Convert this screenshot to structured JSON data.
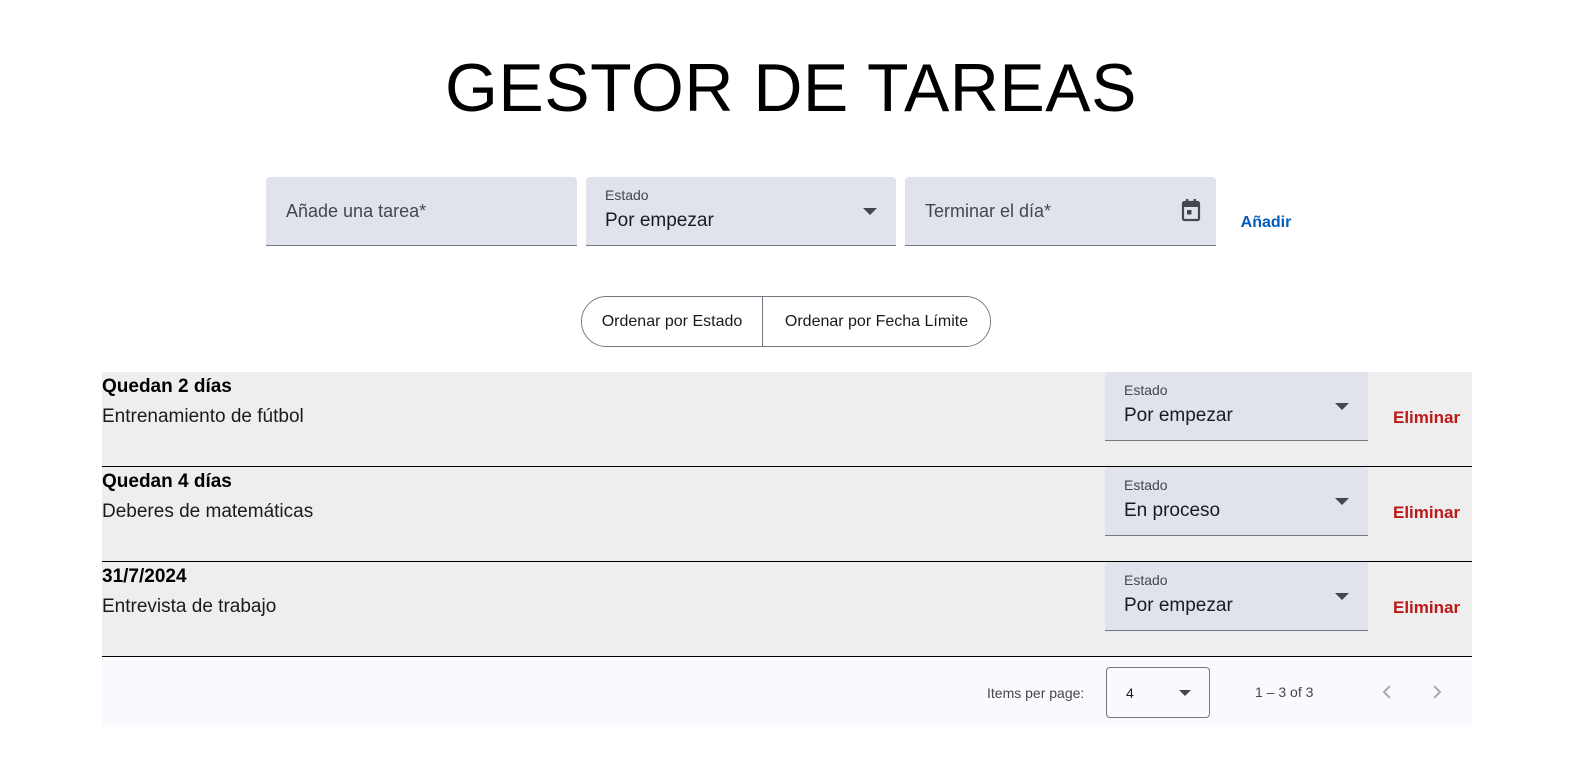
{
  "header": {
    "title": "GESTOR DE TAREAS"
  },
  "form": {
    "task_placeholder": "Añade una tarea*",
    "status_label": "Estado",
    "status_value": "Por empezar",
    "date_placeholder": "Terminar el día*",
    "add_label": "Añadir"
  },
  "sort": {
    "by_status": "Ordenar por Estado",
    "by_deadline": "Ordenar por Fecha Límite"
  },
  "tasks": [
    {
      "when": "Quedan 2 días",
      "name": "Entrenamiento de fútbol",
      "status_label": "Estado",
      "status": "Por empezar",
      "delete": "Eliminar"
    },
    {
      "when": "Quedan 4 días",
      "name": "Deberes de matemáticas",
      "status_label": "Estado",
      "status": "En proceso",
      "delete": "Eliminar"
    },
    {
      "when": "31/7/2024",
      "name": "Entrevista de trabajo",
      "status_label": "Estado",
      "status": "Por empezar",
      "delete": "Eliminar"
    }
  ],
  "paginator": {
    "items_per_page_label": "Items per page:",
    "items_per_page": "4",
    "range": "1 – 3 of 3"
  },
  "icons": {
    "calendar": "calendar-icon",
    "dropdown": "chevron-down-icon",
    "prev": "chevron-left-icon",
    "next": "chevron-right-icon"
  },
  "colors": {
    "field_bg": "#e0e2ec",
    "row_bg": "#eeeeee",
    "primary": "#005cbb",
    "danger": "#ba1a1a"
  }
}
